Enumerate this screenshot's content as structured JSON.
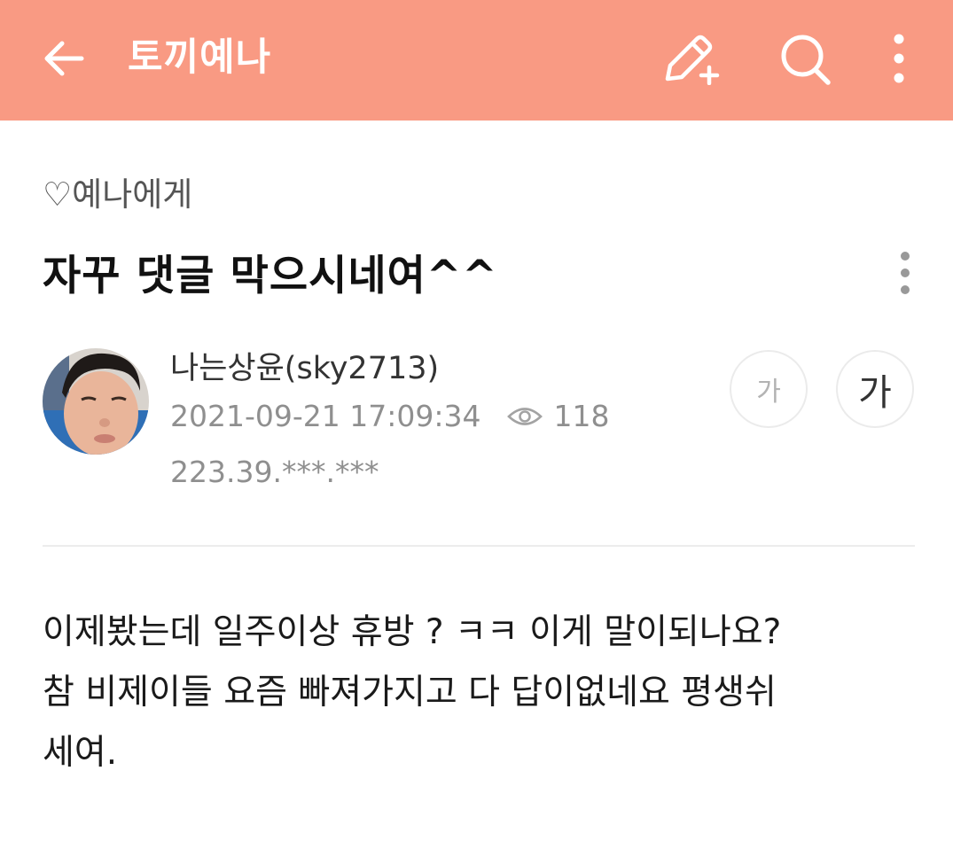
{
  "header": {
    "title": "토끼예나",
    "background_color": "#f99a83",
    "icons": [
      "arrow-left-icon",
      "pencil-plus-icon",
      "search-icon",
      "more-vertical-icon"
    ]
  },
  "post": {
    "category": "♡예나에게",
    "title": "자꾸 댓글 막으시네여^^",
    "author": "나는상윤(sky2713)",
    "date": "2021-09-21 17:09:34",
    "views": "118",
    "ip": "223.39.***.***",
    "font_small_label": "가",
    "font_large_label": "가",
    "body_lines": [
      "이제봤는데 일주이상 휴방 ? ㅋㅋ 이게 말이되나요?",
      "참 비제이들 요즘 빠져가지고 다 답이없네요 평생쉬",
      "세여."
    ]
  }
}
